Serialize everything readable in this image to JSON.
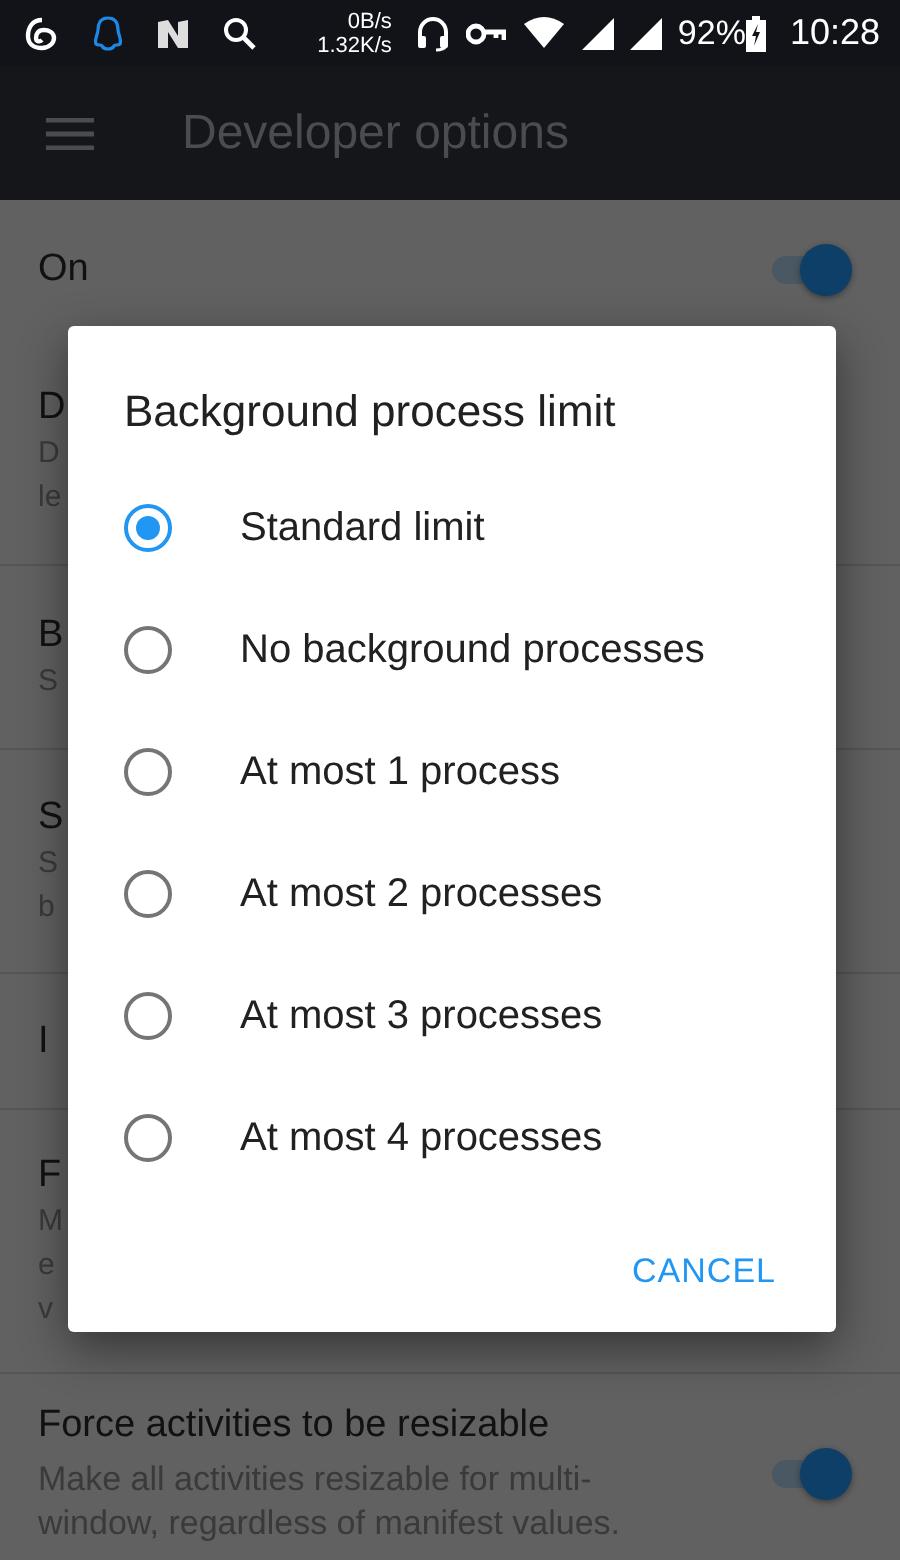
{
  "status_bar": {
    "net_up": "0B/s",
    "net_down": "1.32K/s",
    "battery": "92%",
    "time": "10:28"
  },
  "toolbar": {
    "title": "Developer options"
  },
  "master_switch": {
    "label": "On",
    "on": true
  },
  "settings": [
    {
      "title": "D",
      "summary_lines": [
        "D",
        "le"
      ]
    },
    {
      "title": "B",
      "summary_lines": [
        "S"
      ]
    },
    {
      "title": "S",
      "summary_lines": [
        "S",
        "b"
      ]
    },
    {
      "title": "I"
    },
    {
      "title": "F",
      "summary_lines": [
        "M",
        "e",
        "v"
      ]
    }
  ],
  "resizable_setting": {
    "title": "Force activities to be resizable",
    "summary": "Make all activities resizable for multi-window, regardless of manifest values.",
    "on": true
  },
  "dialog": {
    "title": "Background process limit",
    "options": [
      {
        "label": "Standard limit",
        "selected": true
      },
      {
        "label": "No background processes",
        "selected": false
      },
      {
        "label": "At most 1 process",
        "selected": false
      },
      {
        "label": "At most 2 processes",
        "selected": false
      },
      {
        "label": "At most 3 processes",
        "selected": false
      },
      {
        "label": "At most 4 processes",
        "selected": false
      }
    ],
    "button": "CANCEL"
  }
}
